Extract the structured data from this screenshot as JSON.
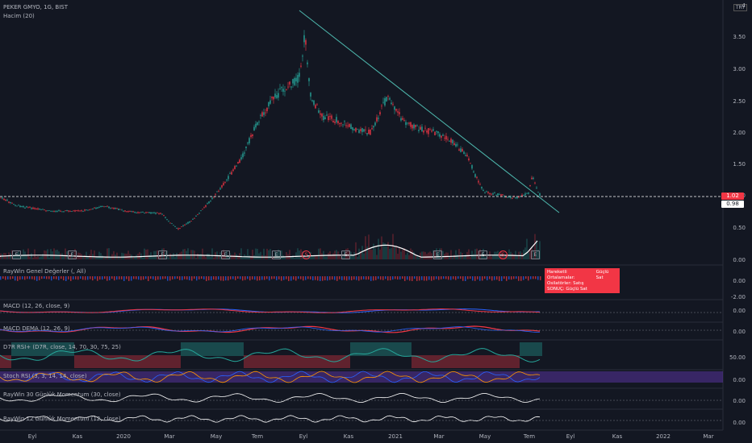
{
  "header": {
    "symbol_title": "PEKER GMYO, 1G, BIST",
    "volume_label": "Hacim (20)",
    "currency": "TRY"
  },
  "price_axis": {
    "ticks": [
      "4",
      "3.50",
      "3.00",
      "2.50",
      "2.00",
      "1.50",
      "1.00",
      "0.50",
      "0.00"
    ],
    "current_price": "1.02",
    "ref_price": "0.98"
  },
  "indicators": [
    {
      "label": "RayWin Genel Değerler (, All)",
      "value": "0.00"
    },
    {
      "label": "MACD (12, 26, close, 9)",
      "value": "0.00"
    },
    {
      "label": "MACD DEMA (12, 26, 9)",
      "value": "0.00"
    },
    {
      "label": "D7R RSI+ (D7R, close, 14, 70, 30, 75, 25)",
      "value": "50.00"
    },
    {
      "label": "Stoch RSI (3, 3, 14, 14, close)",
      "value": "0.00"
    },
    {
      "label": "RayWin 30 Günlük Momentum (30, close)",
      "value": "0.00"
    },
    {
      "label": "RayWin 12 Günlük Momentum (12, close)",
      "value": "0.00"
    }
  ],
  "extra_axis_values": [
    "-2.00"
  ],
  "popup": {
    "row1_label": "Hareketli Ortalamalar:",
    "row1_value": "Güçlü Sat",
    "row2_label": "Osilatörler: Satış",
    "row2_value": "",
    "row3_label": "SONUÇ:",
    "row3_value": "Güçlü Sat"
  },
  "time_axis": [
    "Eyl",
    "Kas",
    "2020",
    "Mar",
    "May",
    "Tem",
    "Eyl",
    "Kas",
    "2021",
    "Mar",
    "May",
    "Tem",
    "Eyl",
    "Kas",
    "2022",
    "Mar"
  ],
  "badges": [
    "E",
    "E",
    "E",
    "E",
    "E",
    "S",
    "E",
    "E",
    "E",
    "S",
    "E"
  ],
  "colors": {
    "up": "#26a69a",
    "down": "#f23645",
    "trendline": "#4db6ac",
    "background": "#131722"
  }
}
